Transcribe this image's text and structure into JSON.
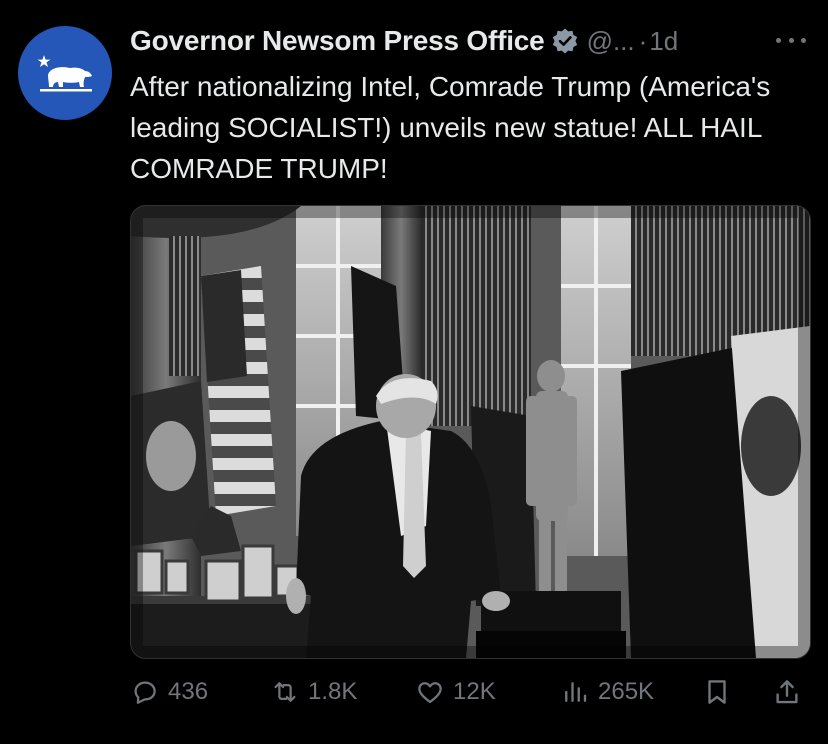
{
  "account": {
    "display_name": "Governor Newsom Press Office",
    "handle": "@...",
    "time_sep": "·",
    "time": "1d",
    "avatar_color": "#2457b8",
    "verified_color": "#8b98a5"
  },
  "tweet": {
    "text": "After nationalizing Intel, Comrade Trump (America's leading SOCIALIST!) unveils new statue! ALL HAIL COMRADE TRUMP!"
  },
  "media": {
    "kind": "photo"
  },
  "actions": {
    "reply_icon": "reply-icon",
    "reply_count": "436",
    "repost_icon": "repost-icon",
    "repost_count": "1.8K",
    "like_icon": "heart-icon",
    "like_count": "12K",
    "views_icon": "views-icon",
    "views_count": "265K",
    "bookmark_icon": "bookmark-icon",
    "share_icon": "share-icon"
  }
}
